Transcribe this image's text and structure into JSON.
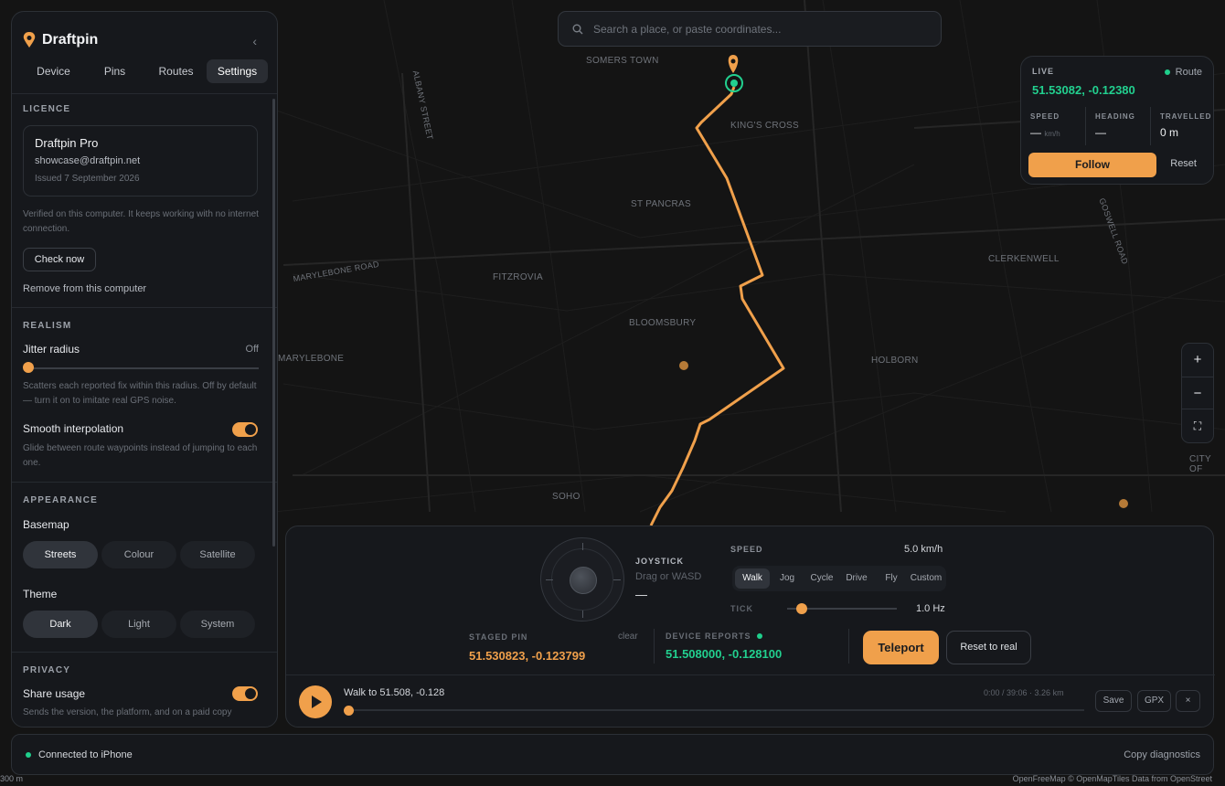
{
  "app": {
    "title": "Draftpin"
  },
  "sidebar": {
    "tabs": [
      {
        "label": "Device",
        "active": false
      },
      {
        "label": "Pins",
        "active": false
      },
      {
        "label": "Routes",
        "active": false
      },
      {
        "label": "Settings",
        "active": true
      }
    ],
    "licence": {
      "heading": "LICENCE",
      "product": "Draftpin Pro",
      "email": "showcase@draftpin.net",
      "issued": "Issued 7 September 2026",
      "note": "Verified on this computer. It keeps working with no internet connection.",
      "check_label": "Check now",
      "remove_label": "Remove from this computer"
    },
    "realism": {
      "heading": "REALISM",
      "jitter_label": "Jitter radius",
      "jitter_value": "Off",
      "jitter_level": 0,
      "jitter_note": "Scatters each reported fix within this radius. Off by default — turn it on to imitate real GPS noise.",
      "smooth_label": "Smooth interpolation",
      "smooth_on": true,
      "smooth_note": "Glide between route waypoints instead of jumping to each one."
    },
    "appearance": {
      "heading": "APPEARANCE",
      "basemap_label": "Basemap",
      "basemap_options": [
        "Streets",
        "Colour",
        "Satellite"
      ],
      "basemap_selected": "Streets",
      "theme_label": "Theme",
      "theme_options": [
        "Dark",
        "Light",
        "System"
      ],
      "theme_selected": "Dark"
    },
    "privacy": {
      "heading": "PRIVACY",
      "share_label": "Share usage",
      "share_on": true,
      "share_note": "Sends the version, the platform, and on a paid copy"
    }
  },
  "search": {
    "placeholder": "Search a place, or paste coordinates..."
  },
  "live": {
    "label": "LIVE",
    "mode": "Route",
    "coords": "51.53082, -0.12380",
    "speed_label": "SPEED",
    "speed_value": "—",
    "speed_unit": "km/h",
    "heading_label": "HEADING",
    "heading_value": "—",
    "travelled_label": "TRAVELLED",
    "travelled_value": "0 m",
    "follow_label": "Follow",
    "reset_label": "Reset"
  },
  "map": {
    "labels": [
      "SOMERS TOWN",
      "KING'S CROSS",
      "ST PANCRAS",
      "FITZROVIA",
      "BLOOMSBURY",
      "MARYLEBONE",
      "HOLBORN",
      "CLERKENWELL",
      "SOHO",
      "CITY OF",
      "MARYLEBONE ROAD",
      "ALBANY STREET",
      "GOSWELL ROAD"
    ],
    "scale": "300 m",
    "attribution": "OpenFreeMap © OpenMapTiles Data from OpenStreet"
  },
  "zoom": {
    "in": "+",
    "out": "−",
    "fit": "⛶"
  },
  "control": {
    "joystick_label": "JOYSTICK",
    "joystick_hint": "Drag or WASD",
    "joystick_value": "—",
    "speed_label": "SPEED",
    "speed_value": "5.0 km/h",
    "modes": [
      "Walk",
      "Jog",
      "Cycle",
      "Drive",
      "Fly",
      "Custom"
    ],
    "mode_selected": "Walk",
    "tick_label": "TICK",
    "tick_value": "1.0 Hz",
    "tick_level": 0.13,
    "staged_label": "STAGED PIN",
    "staged_clear": "clear",
    "staged_coords": "51.530823, -0.123799",
    "device_label": "DEVICE REPORTS",
    "device_coords": "51.508000, -0.128100",
    "teleport_label": "Teleport",
    "reset_label": "Reset to real"
  },
  "playback": {
    "title": "Walk to 51.508, -0.128",
    "progress": 0,
    "time": "0:00 / 39:06",
    "distance": "3.26 km",
    "save_label": "Save",
    "gpx_label": "GPX",
    "close_label": "×"
  },
  "status": {
    "connection": "Connected to iPhone",
    "diagnostics_label": "Copy diagnostics"
  },
  "colors": {
    "accent": "#f0a04b",
    "live": "#22d08f",
    "background": "#121212"
  }
}
